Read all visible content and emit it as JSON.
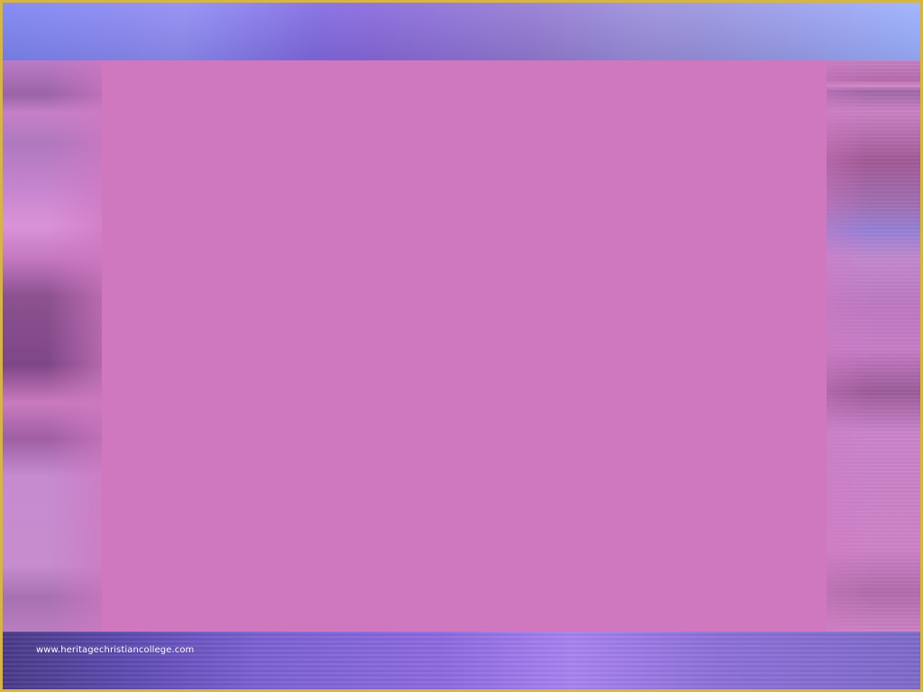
{
  "footer": {
    "url_text": "www.heritagechristiancollege.com"
  },
  "colors": {
    "main_pink": "#cf78c0",
    "border_gold": "#d7b640",
    "top_band": "#7d84f3",
    "bottom_band": "#7b61d2"
  }
}
